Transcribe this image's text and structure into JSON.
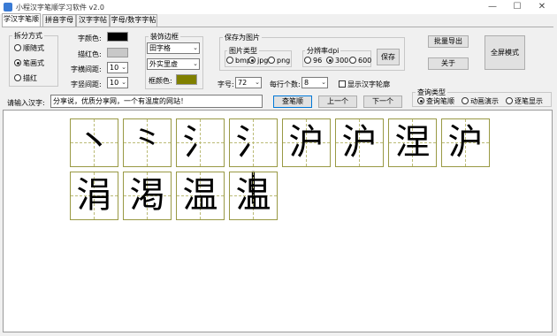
{
  "window": {
    "title": "小程汉字笔顺学习软件 v2.0"
  },
  "tabs": [
    "学汉字笔顺",
    "拼音字母",
    "汉字字帖",
    "字母/数字字帖"
  ],
  "split_mode": {
    "legend": "拆分方式",
    "options": [
      {
        "label": "顺随式",
        "selected": false
      },
      {
        "label": "笔画式",
        "selected": true
      },
      {
        "label": "描红",
        "selected": false
      }
    ]
  },
  "style": {
    "font_color_label": "字颜色:",
    "font_color": "#000000",
    "trace_color_label": "描红色:",
    "trace_color": "#c8c8c8",
    "char_spacing_label": "字横间距:",
    "char_spacing": "10",
    "line_spacing_label": "字竖间距:",
    "line_spacing": "10"
  },
  "border": {
    "legend": "装饰边框",
    "grid_type": "田字格",
    "line_type": "外实里虚",
    "border_color_label": "框颜色:",
    "border_color": "#808000"
  },
  "save": {
    "legend": "保存为图片",
    "image_type_legend": "图片类型",
    "image_types": [
      {
        "label": "bmp",
        "selected": false
      },
      {
        "label": "jpg",
        "selected": true
      },
      {
        "label": "png",
        "selected": false
      }
    ],
    "dpi_legend": "分辨率dpi",
    "dpis": [
      {
        "label": "96",
        "selected": false
      },
      {
        "label": "300",
        "selected": true
      },
      {
        "label": "600",
        "selected": false
      }
    ],
    "save_button": "保存"
  },
  "right_buttons": {
    "batch_export": "批量导出",
    "about": "关于",
    "fullscreen": "全屏模式"
  },
  "size": {
    "label": "字号:",
    "value": "72"
  },
  "per_row": {
    "label": "每行个数:",
    "value": "8"
  },
  "outline": {
    "label": "显示汉字轮廓",
    "checked": false
  },
  "query": {
    "legend": "查询类型",
    "options": [
      {
        "label": "查询笔顺",
        "selected": true
      },
      {
        "label": "动画演示",
        "selected": false
      },
      {
        "label": "逐笔显示",
        "selected": false
      }
    ]
  },
  "input": {
    "label": "请输入汉字:",
    "value": "分享说，优质分享网，一个有温度的网站！"
  },
  "nav": {
    "query_button": "查笔顺",
    "prev_button": "上一个",
    "next_button": "下一个"
  },
  "strokes": [
    "丶",
    "⺀",
    "氵",
    "氵丨",
    "沪",
    "沪",
    "涅",
    "沪",
    "涓",
    "渇",
    "温",
    "温"
  ]
}
